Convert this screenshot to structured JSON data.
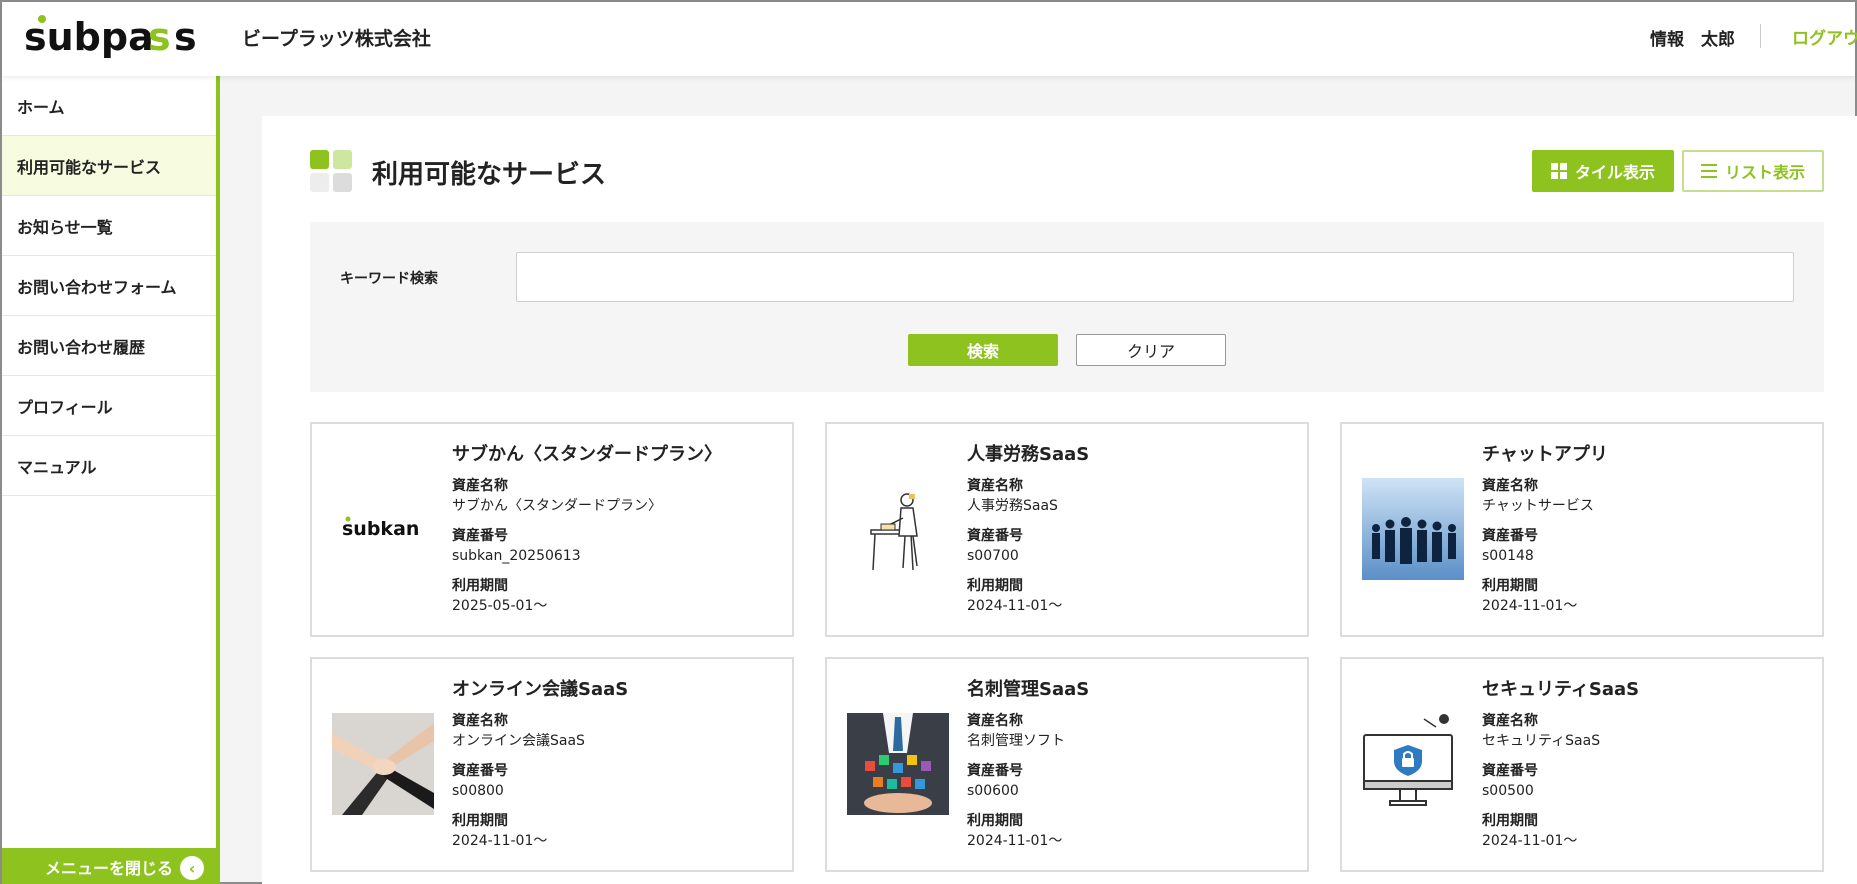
{
  "header": {
    "company": "ビープラッツ株式会社",
    "user_name": "情報　太郎",
    "logout_label": "ログアウ",
    "brand_color": "#8dc21f"
  },
  "sidebar": {
    "items": [
      {
        "label": "ホーム",
        "active": false
      },
      {
        "label": "利用可能なサービス",
        "active": true
      },
      {
        "label": "お知らせ一覧",
        "active": false
      },
      {
        "label": "お問い合わせフォーム",
        "active": false
      },
      {
        "label": "お問い合わせ履歴",
        "active": false
      },
      {
        "label": "プロフィール",
        "active": false
      },
      {
        "label": "マニュアル",
        "active": false
      }
    ],
    "close_label": "メニューを閉じる",
    "close_icon": "chevron-left-icon"
  },
  "main": {
    "title": "利用可能なサービス",
    "view_buttons": {
      "tile_label": "タイル表示",
      "list_label": "リスト表示"
    },
    "search": {
      "label": "キーワード検索",
      "value": "",
      "placeholder": "",
      "search_button": "検索",
      "clear_button": "クリア"
    },
    "field_labels": {
      "asset_name": "資産名称",
      "asset_number": "資産番号",
      "period": "利用期間"
    },
    "cards": [
      {
        "title": "サブかん〈スタンダードプラン〉",
        "asset_name": "サブかん〈スタンダードプラン〉",
        "asset_number": "subkan_20250613",
        "period": "2025-05-01～",
        "thumb": "subkan-logo"
      },
      {
        "title": "人事労務SaaS",
        "asset_name": "人事労務SaaS",
        "asset_number": "s00700",
        "period": "2024-11-01～",
        "thumb": "person-at-desk-illustration"
      },
      {
        "title": "チャットアプリ",
        "asset_name": "チャットサービス",
        "asset_number": "s00148",
        "period": "2024-11-01～",
        "thumb": "business-people-photo"
      },
      {
        "title": "オンライン会議SaaS",
        "asset_name": "オンライン会議SaaS",
        "asset_number": "s00800",
        "period": "2024-11-01～",
        "thumb": "stacked-hands-photo"
      },
      {
        "title": "名刺管理SaaS",
        "asset_name": "名刺管理ソフト",
        "asset_number": "s00600",
        "period": "2024-11-01～",
        "thumb": "businessman-apps-photo"
      },
      {
        "title": "セキュリティSaaS",
        "asset_name": "セキュリティSaaS",
        "asset_number": "s00500",
        "period": "2024-11-01～",
        "thumb": "security-monitor-illustration"
      }
    ]
  }
}
